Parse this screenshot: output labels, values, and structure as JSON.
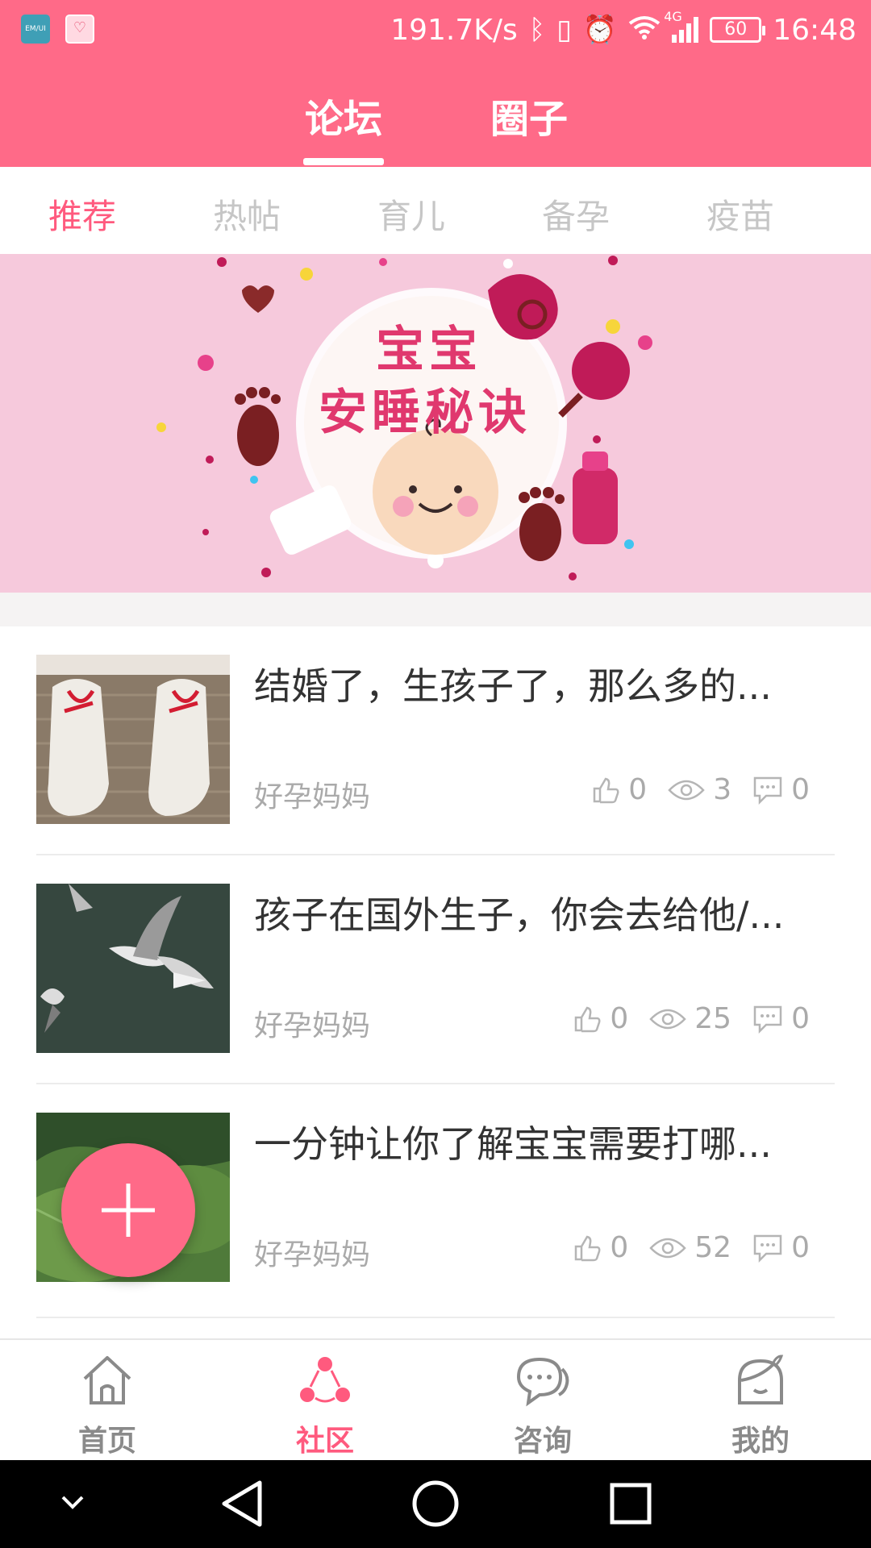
{
  "status_bar": {
    "app_icon_1_text": "EM/UI",
    "speed": "191.7K/s",
    "network": "4G",
    "battery": "60",
    "time": "16:48"
  },
  "top_tabs": [
    "论坛",
    "圈子"
  ],
  "sub_tabs": [
    "推荐",
    "热帖",
    "育儿",
    "备孕",
    "疫苗"
  ],
  "banner": {
    "line1": "宝宝",
    "line2": "安睡秘诀"
  },
  "posts": [
    {
      "title": "结婚了，生孩子了，那么多的...",
      "author": "好孕妈妈",
      "likes": "0",
      "views": "3",
      "comments": "0"
    },
    {
      "title": "孩子在国外生子，你会去给他/...",
      "author": "好孕妈妈",
      "likes": "0",
      "views": "25",
      "comments": "0"
    },
    {
      "title": "一分钟让你了解宝宝需要打哪...",
      "author": "好孕妈妈",
      "likes": "0",
      "views": "52",
      "comments": "0"
    }
  ],
  "bottom_nav": [
    "首页",
    "社区",
    "咨询",
    "我的"
  ],
  "colors": {
    "accent": "#ff6a88",
    "active_text": "#ff5a7e",
    "inactive_text": "#c6c6c6"
  }
}
